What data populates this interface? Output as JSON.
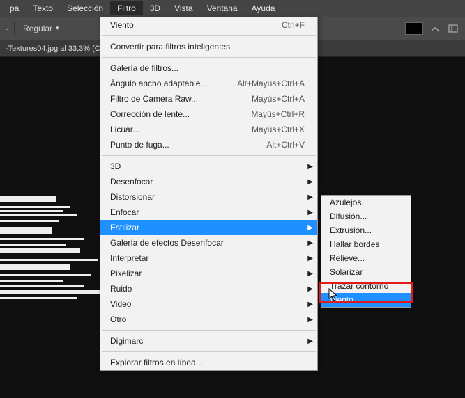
{
  "menubar": {
    "items": [
      "pa",
      "Texto",
      "Selección",
      "Filtro",
      "3D",
      "Vista",
      "Ventana",
      "Ayuda"
    ],
    "active_index": 3
  },
  "toolbar": {
    "left_label": "-",
    "regular_label": "Regular"
  },
  "tabbar": {
    "title": "-Textures04.jpg al 33,3% (C"
  },
  "filter_menu": {
    "groups": [
      [
        {
          "label": "Viento",
          "shortcut": "Ctrl+F"
        }
      ],
      [
        {
          "label": "Convertir para filtros inteligentes"
        }
      ],
      [
        {
          "label": "Galería de filtros..."
        },
        {
          "label": "Ángulo ancho adaptable...",
          "shortcut": "Alt+Mayús+Ctrl+A"
        },
        {
          "label": "Filtro de Camera Raw...",
          "shortcut": "Mayús+Ctrl+A"
        },
        {
          "label": "Corrección de lente...",
          "shortcut": "Mayús+Ctrl+R"
        },
        {
          "label": "Licuar...",
          "shortcut": "Mayús+Ctrl+X"
        },
        {
          "label": "Punto de fuga...",
          "shortcut": "Alt+Ctrl+V"
        }
      ],
      [
        {
          "label": "3D",
          "submenu": true
        },
        {
          "label": "Desenfocar",
          "submenu": true
        },
        {
          "label": "Distorsionar",
          "submenu": true
        },
        {
          "label": "Enfocar",
          "submenu": true
        },
        {
          "label": "Estilizar",
          "submenu": true,
          "highlight": true
        },
        {
          "label": "Galería de efectos Desenfocar",
          "submenu": true
        },
        {
          "label": "Interpretar",
          "submenu": true
        },
        {
          "label": "Pixelizar",
          "submenu": true
        },
        {
          "label": "Ruido",
          "submenu": true
        },
        {
          "label": "Video",
          "submenu": true
        },
        {
          "label": "Otro",
          "submenu": true
        }
      ],
      [
        {
          "label": "Digimarc",
          "submenu": true
        }
      ],
      [
        {
          "label": "Explorar filtros en línea..."
        }
      ]
    ]
  },
  "estilizar_submenu": {
    "items": [
      {
        "label": "Azulejos..."
      },
      {
        "label": "Difusión..."
      },
      {
        "label": "Extrusión..."
      },
      {
        "label": "Hallar bordes"
      },
      {
        "label": "Relieve..."
      },
      {
        "label": "Solarizar"
      },
      {
        "label": "Trazar contorno"
      },
      {
        "label": "Viento...",
        "highlight": true
      }
    ]
  }
}
